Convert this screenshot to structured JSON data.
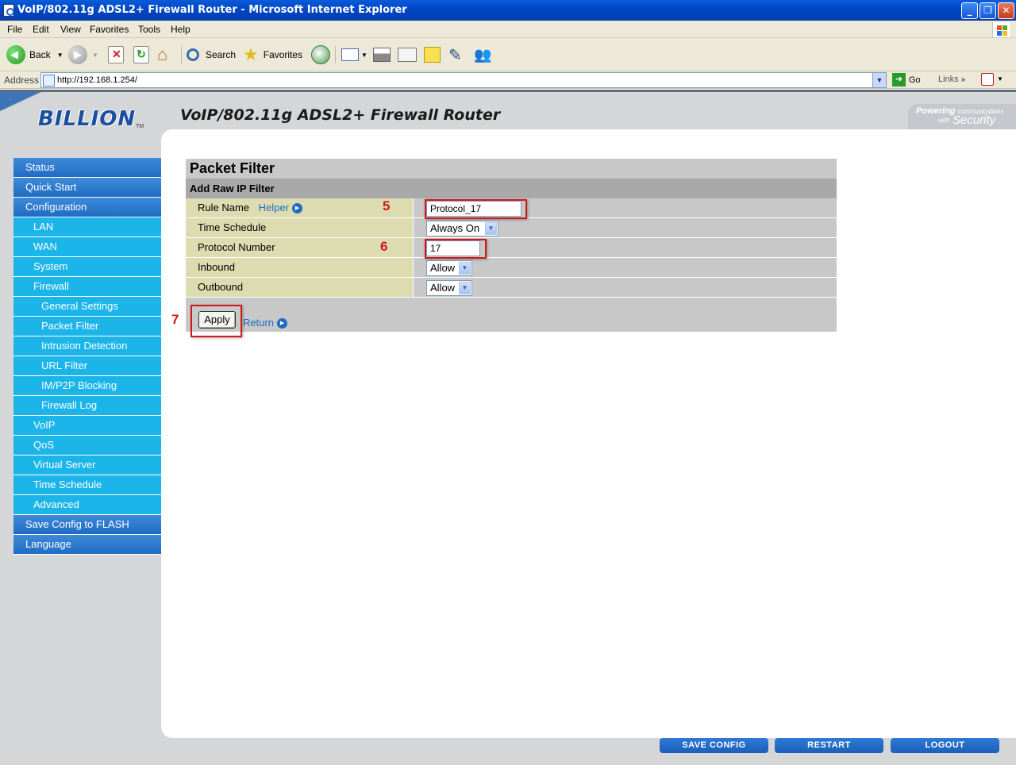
{
  "window": {
    "title": "VoIP/802.11g ADSL2+ Firewall Router - Microsoft Internet Explorer",
    "controls": [
      "_",
      "❐",
      "✕"
    ]
  },
  "menu": [
    "File",
    "Edit",
    "View",
    "Favorites",
    "Tools",
    "Help"
  ],
  "toolbar": {
    "back_label": "Back",
    "search_label": "Search",
    "favorites_label": "Favorites"
  },
  "address": {
    "label": "Address",
    "url": "http://192.168.1.254/",
    "go_label": "Go",
    "links_label": "Links"
  },
  "router": {
    "logo": "BILLION",
    "logo_tm": "TM",
    "product_title": "VoIP/802.11g ADSL2+ Firewall Router",
    "tagline_powering": "Powering",
    "tagline_communications": "communications",
    "tagline_with": "with",
    "tagline_security": "Security"
  },
  "sidebar": {
    "items": [
      {
        "label": "Status",
        "level": 0
      },
      {
        "label": "Quick Start",
        "level": 0
      },
      {
        "label": "Configuration",
        "level": 0
      },
      {
        "label": "LAN",
        "level": 1
      },
      {
        "label": "WAN",
        "level": 1
      },
      {
        "label": "System",
        "level": 1
      },
      {
        "label": "Firewall",
        "level": 1
      },
      {
        "label": "General Settings",
        "level": 2
      },
      {
        "label": "Packet Filter",
        "level": 2
      },
      {
        "label": "Intrusion Detection",
        "level": 2
      },
      {
        "label": "URL Filter",
        "level": 2
      },
      {
        "label": "IM/P2P Blocking",
        "level": 2
      },
      {
        "label": "Firewall Log",
        "level": 2
      },
      {
        "label": "VoIP",
        "level": 1
      },
      {
        "label": "QoS",
        "level": 1
      },
      {
        "label": "Virtual Server",
        "level": 1
      },
      {
        "label": "Time Schedule",
        "level": 1
      },
      {
        "label": "Advanced",
        "level": 1
      },
      {
        "label": "Save Config to FLASH",
        "level": 0
      },
      {
        "label": "Language",
        "level": 0
      }
    ]
  },
  "form": {
    "title": "Packet Filter",
    "subtitle": "Add Raw IP Filter",
    "rule_name_label": "Rule Name",
    "helper_label": "Helper",
    "rule_name_value": "Protocol_17",
    "time_schedule_label": "Time Schedule",
    "time_schedule_value": "Always On",
    "protocol_number_label": "Protocol Number",
    "protocol_number_value": "17",
    "inbound_label": "Inbound",
    "inbound_value": "Allow",
    "outbound_label": "Outbound",
    "outbound_value": "Allow",
    "apply_label": "Apply",
    "return_label": "Return"
  },
  "annotations": {
    "step_rule_name": "5",
    "step_protocol": "6",
    "step_apply": "7",
    "color": "#d01818"
  },
  "footer_buttons": [
    "SAVE CONFIG",
    "RESTART",
    "LOGOUT"
  ]
}
